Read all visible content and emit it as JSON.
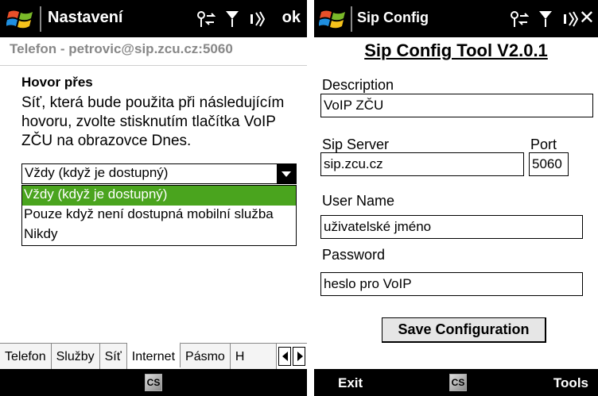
{
  "left": {
    "title": "Nastavení",
    "ok_label": "ok",
    "account": "Telefon - petrovic@sip.zcu.cz:5060",
    "section_title": "Hovor přes",
    "description": "Síť, která bude použita při následujícím hovoru, zvolte stisknutím tlačítka VoIP ZČU na obrazovce Dnes.",
    "combo_value": "Vždy (když je dostupný)",
    "options": [
      "Vždy (když je dostupný)",
      "Pouze když není dostupná mobilní služba",
      "Nikdy"
    ],
    "tabs": [
      "Telefon",
      "Služby",
      "Síť",
      "Internet",
      "Pásmo",
      "H"
    ],
    "active_tab": "Internet",
    "cs_label": "CS"
  },
  "right": {
    "title": "Sip Config",
    "tool_title": "Sip Config Tool V2.0.1",
    "description_label": "Description",
    "description_value": "VoIP ZČU",
    "server_label": "Sip Server",
    "server_value": "sip.zcu.cz",
    "port_label": "Port",
    "port_value": "5060",
    "username_label": "User Name",
    "username_value": "uživatelské jméno",
    "password_label": "Password",
    "password_value": "heslo pro VoIP",
    "save_label": "Save Configuration",
    "exit_label": "Exit",
    "tools_label": "Tools",
    "cs_label": "CS"
  },
  "colors": {
    "titlebar": "#000000",
    "selection": "#4aa41e",
    "subheader_text": "#888888"
  }
}
